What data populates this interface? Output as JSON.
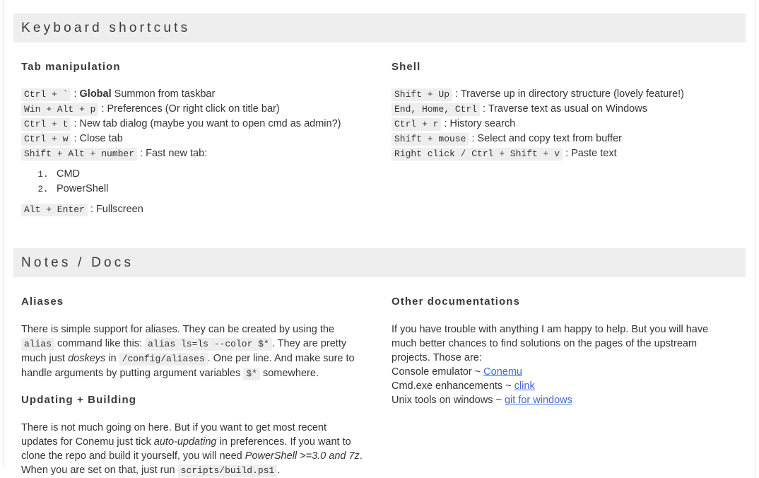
{
  "theme": {
    "bar_bg": "#eeeeee",
    "code_bg": "#eeeeee",
    "text": "#333333",
    "link": "#4169d1",
    "rule": "#e4e4e4"
  },
  "sections": {
    "keyboard_shortcuts": {
      "title": "Keyboard shortcuts",
      "tab_manipulation": {
        "heading": "Tab manipulation",
        "shortcuts": [
          {
            "keys": "Ctrl + `",
            "sep": ":",
            "strong": "Global",
            "desc": "Summon from taskbar"
          },
          {
            "keys": "Win + Alt + p",
            "sep": ":",
            "strong": "",
            "desc": "Preferences (Or right click on title bar)"
          },
          {
            "keys": "Ctrl + t",
            "sep": ":",
            "strong": "",
            "desc": "New tab dialog (maybe you want to open cmd as admin?)"
          },
          {
            "keys": "Ctrl + w",
            "sep": ":",
            "strong": "",
            "desc": "Close tab"
          },
          {
            "keys": "Shift + Alt + number",
            "sep": ":",
            "strong": "",
            "desc": "Fast new tab:"
          }
        ],
        "fast_tab_list": [
          "CMD",
          "PowerShell"
        ],
        "trailing_shortcut": {
          "keys": "Alt + Enter",
          "sep": ":",
          "strong": "",
          "desc": "Fullscreen"
        }
      },
      "shell": {
        "heading": "Shell",
        "shortcuts": [
          {
            "keys": "Shift + Up",
            "sep": ":",
            "strong": "",
            "desc": "Traverse up in directory structure (lovely feature!)"
          },
          {
            "keys": "End, Home, Ctrl",
            "sep": ":",
            "strong": "",
            "desc": "Traverse text as usual on Windows"
          },
          {
            "keys": "Ctrl + r",
            "sep": ":",
            "strong": "",
            "desc": "History search"
          },
          {
            "keys": "Shift + mouse",
            "sep": ":",
            "strong": "",
            "desc": "Select and copy text from buffer"
          },
          {
            "keys": "Right click / Ctrl + Shift + v",
            "sep": ":",
            "strong": "",
            "desc": "Paste text"
          }
        ]
      }
    },
    "notes_docs": {
      "title": "Notes / Docs",
      "aliases": {
        "heading": "Aliases",
        "p1_a": "There is simple support for aliases. They can be created by using the ",
        "p1_code1": "alias",
        "p1_b": " command like this: ",
        "p1_code2": "alias ls=ls --color $*",
        "p1_c": ". They are pretty much just ",
        "p1_em": "doskeys",
        "p1_d": " in ",
        "p1_code3": "/config/aliases",
        "p1_e": ". One per line. And make sure to handle arguments by putting argument variables ",
        "p1_code4": "$*",
        "p1_f": " somewhere."
      },
      "updating": {
        "heading": "Updating + Building",
        "p1_a": "There is not much going on here. But if you want to get most recent updates for Conemu just tick ",
        "p1_em1": "auto-updating",
        "p1_b": " in preferences. If you want to clone the repo and build it yourself, you will need ",
        "p1_em2": "PowerShell >=3.0 and 7z",
        "p1_c": ". When you are set on that, just run ",
        "p1_code1": "scripts/build.ps1",
        "p1_d": "."
      },
      "other_docs": {
        "heading": "Other documentations",
        "intro": "If you have trouble with anything I am happy to help. But you will have much better chances to find solutions on the pages of the upstream projects. Those are:",
        "links": [
          {
            "label": "Console emulator ~ ",
            "link_text": "Conemu"
          },
          {
            "label": "Cmd.exe enhancements ~ ",
            "link_text": "clink"
          },
          {
            "label": "Unix tools on windows ~ ",
            "link_text": "git for windows"
          }
        ]
      }
    }
  }
}
